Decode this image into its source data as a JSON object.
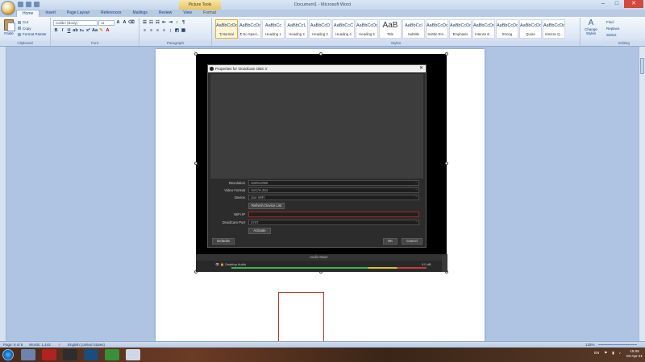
{
  "window": {
    "doc_title": "Document1 - Microsoft Word",
    "context_tab": "Picture Tools"
  },
  "tabs": [
    "Home",
    "Insert",
    "Page Layout",
    "References",
    "Mailings",
    "Review",
    "View",
    "Format"
  ],
  "ribbon": {
    "clipboard": {
      "paste": "Paste",
      "cut": "Cut",
      "copy": "Copy",
      "format_painter": "Format Painter",
      "label": "Clipboard"
    },
    "font": {
      "font_name": "Calibri (Body)",
      "font_size": "11",
      "label": "Font"
    },
    "paragraph": {
      "label": "Paragraph"
    },
    "styles": {
      "label": "Styles",
      "items": [
        {
          "sample": "AaBbCcDc",
          "name": "¶ Normal",
          "big": false
        },
        {
          "sample": "AaBbCcDc",
          "name": "¶ No Spaci...",
          "big": false
        },
        {
          "sample": "AaBbCc",
          "name": "Heading 1",
          "big": false
        },
        {
          "sample": "AaBbCcL",
          "name": "Heading 2",
          "big": false
        },
        {
          "sample": "AaBbCcD",
          "name": "Heading 3",
          "big": false
        },
        {
          "sample": "AaBbCcC",
          "name": "Heading 4",
          "big": false
        },
        {
          "sample": "AaBbCcDc",
          "name": "Heading 5",
          "big": false
        },
        {
          "sample": "AaB",
          "name": "Title",
          "big": true
        },
        {
          "sample": "AaBbCcI",
          "name": "Subtitle",
          "big": false
        },
        {
          "sample": "AaBbCcDc",
          "name": "Subtle Em...",
          "big": false
        },
        {
          "sample": "AaBbCcDc",
          "name": "Emphasis",
          "big": false
        },
        {
          "sample": "AaBbCcDc",
          "name": "Intense E...",
          "big": false
        },
        {
          "sample": "AaBbCcDc",
          "name": "Strong",
          "big": false
        },
        {
          "sample": "AaBbCcDc",
          "name": "Quote",
          "big": false
        },
        {
          "sample": "AaBbCcDc",
          "name": "Intense Q...",
          "big": false
        }
      ],
      "change_styles": "Change Styles"
    },
    "editing": {
      "find": "Find",
      "replace": "Replace",
      "select": "Select",
      "label": "Editing"
    }
  },
  "obs_dialog": {
    "title": "Properties for 'DroidCam OBS 4'",
    "rows": [
      {
        "label": "Resolution",
        "value": "1920x1080"
      },
      {
        "label": "Video Format",
        "value": "AVC/H.264"
      },
      {
        "label": "Device",
        "value": "Use WiFi"
      }
    ],
    "refresh_button": "Refresh Device List",
    "wifi_ip_label": "WiFi IP",
    "wifi_ip_value": "",
    "port_label": "DroidCam Port",
    "port_value": "4747",
    "activate_button": "Activate",
    "defaults_button": "Defaults",
    "ok_button": "OK",
    "cancel_button": "Cancel"
  },
  "mixer": {
    "title": "Audio Mixer",
    "source": "Desktop Audio",
    "level": "0.0 dB"
  },
  "statusbar": {
    "page": "Page: 8 of 8",
    "words": "Words: 1,443",
    "language": "English (United States)",
    "zoom": "125%"
  },
  "taskbar": {
    "lang": "EN",
    "time": "15:09",
    "date": "03-Apr-21"
  }
}
